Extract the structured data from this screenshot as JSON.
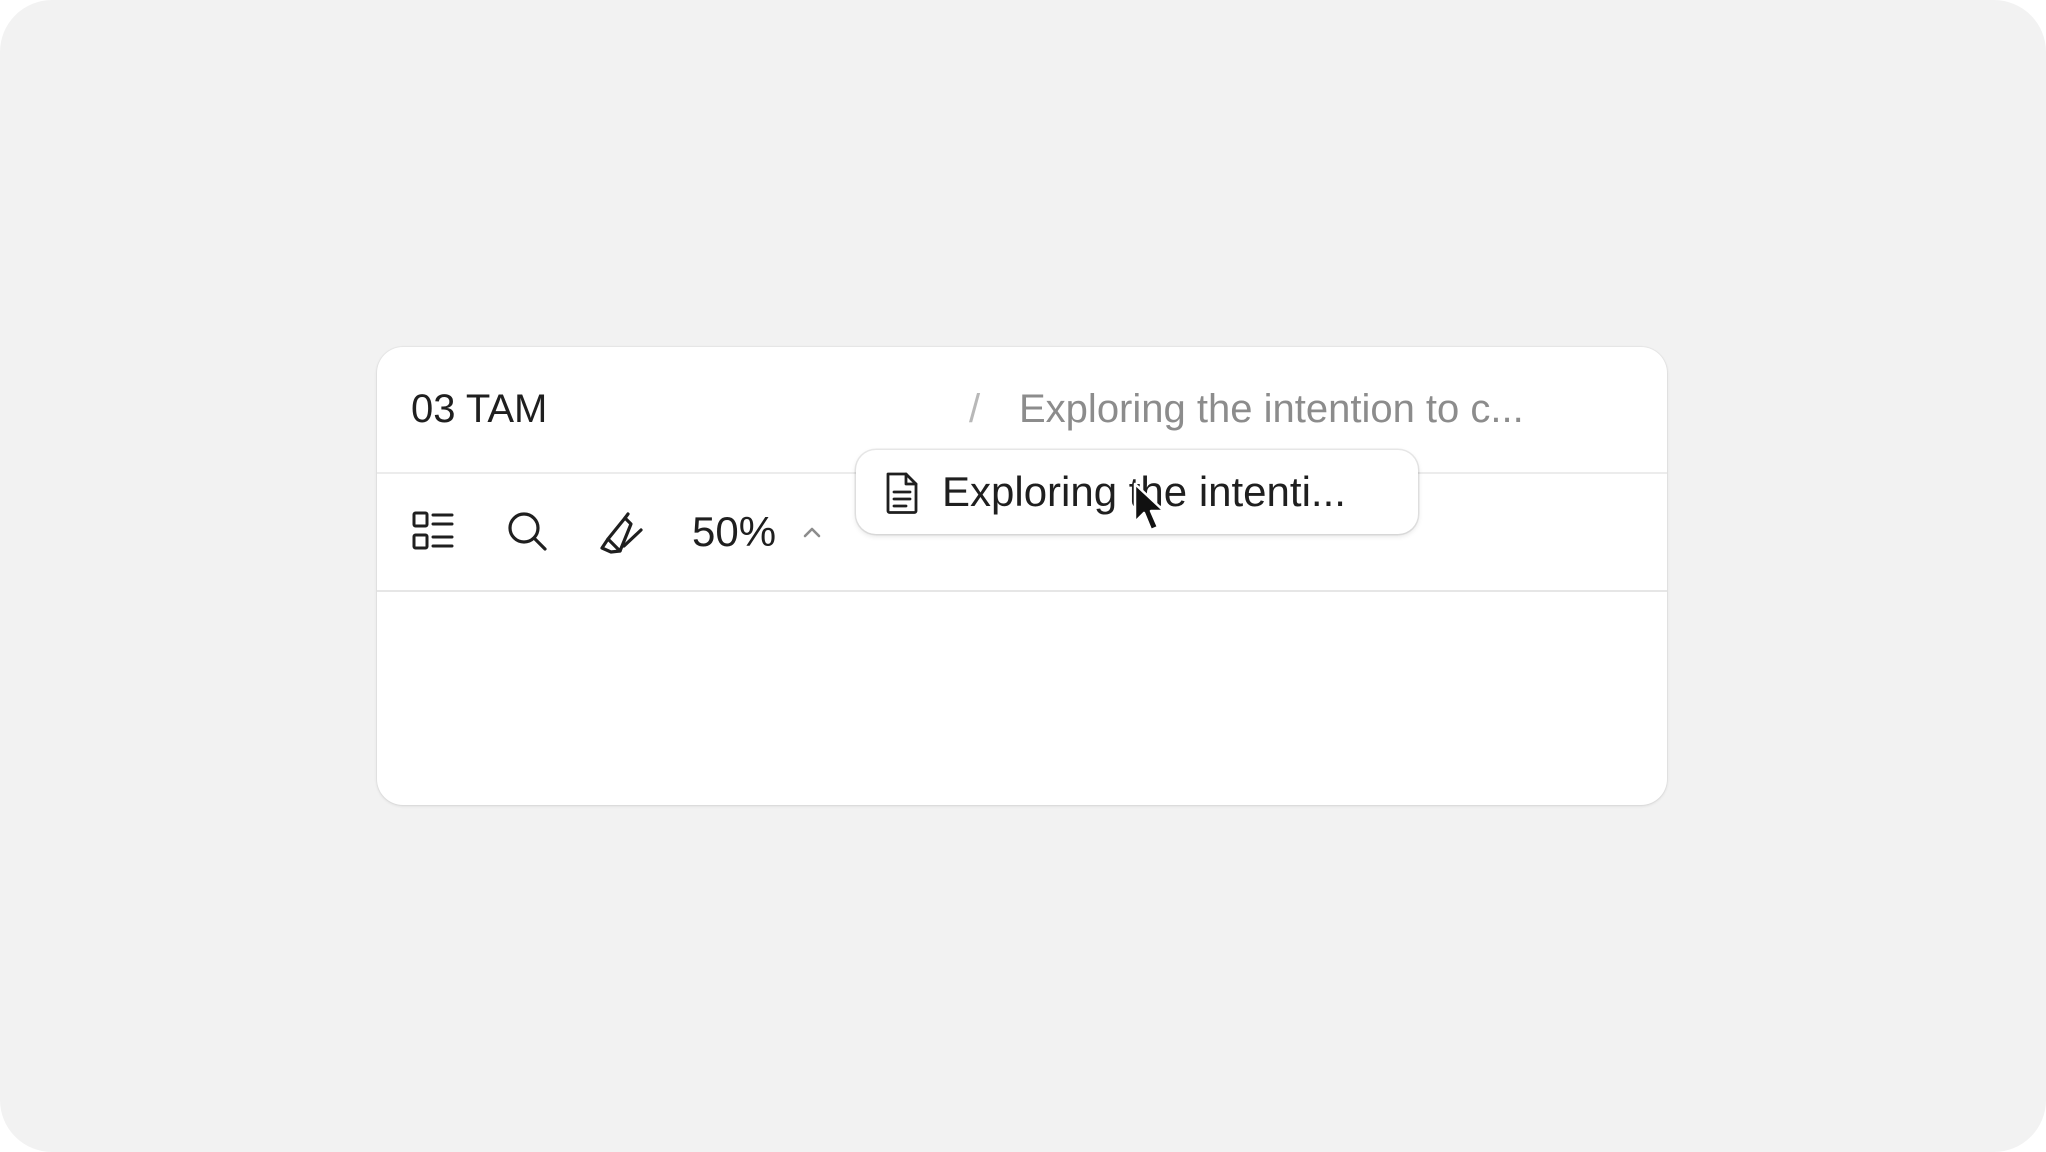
{
  "breadcrumb": {
    "root": "03 TAM",
    "separator": "/",
    "current": "Exploring the intention to c..."
  },
  "toolbar": {
    "tools": [
      {
        "name": "outline",
        "icon": "list-grid-icon"
      },
      {
        "name": "search",
        "icon": "search-icon"
      },
      {
        "name": "annotate",
        "icon": "highlighter-icon"
      }
    ],
    "zoom": {
      "value": "50%",
      "icon": "chevron-up-icon"
    }
  },
  "tooltip": {
    "icon": "document-icon",
    "label": "Exploring the intenti..."
  },
  "cursor": {
    "icon": "arrow-cursor-icon"
  },
  "colors": {
    "background": "#f2f2f2",
    "card": "#ffffff",
    "text": "#1f1f1f",
    "muted_text": "#8c8c8c",
    "separator": "#b8b8b8"
  }
}
